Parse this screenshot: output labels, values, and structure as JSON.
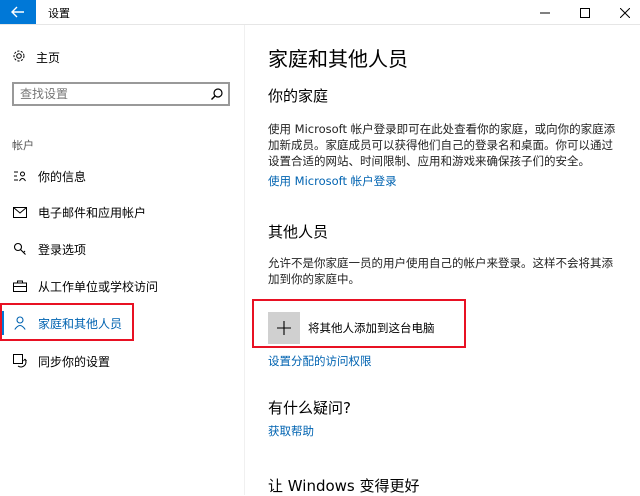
{
  "window": {
    "title": "设置",
    "back_icon": "arrow-left-icon",
    "controls": [
      "minimize-icon",
      "maximize-icon",
      "close-icon"
    ],
    "accent_color": "#0078d7"
  },
  "sidebar": {
    "home_label": "主页",
    "search_placeholder": "查找设置",
    "section_label": "帐户",
    "items": [
      {
        "label": "你的信息",
        "icon": "person-card-icon"
      },
      {
        "label": "电子邮件和应用帐户",
        "icon": "envelope-icon"
      },
      {
        "label": "登录选项",
        "icon": "key-icon"
      },
      {
        "label": "从工作单位或学校访问",
        "icon": "briefcase-icon"
      },
      {
        "label": "家庭和其他人员",
        "icon": "person-icon",
        "active": true
      },
      {
        "label": "同步你的设置",
        "icon": "sync-icon"
      }
    ],
    "highlight_color": "#e81123"
  },
  "main": {
    "title": "家庭和其他人员",
    "family": {
      "heading": "你的家庭",
      "description": "使用 Microsoft 帐户登录即可在此处查看你的家庭，或向你的家庭添加新成员。家庭成员可以获得他们自己的登录名和桌面。你可以通过设置合适的网站、时间限制、应用和游戏来确保孩子们的安全。",
      "link": "使用 Microsoft 帐户登录"
    },
    "others": {
      "heading": "其他人员",
      "description": "允许不是你家庭一员的用户使用自己的帐户来登录。这样不会将其添加到你的家庭中。",
      "add_button": "将其他人添加到这台电脑",
      "assigned_access_link": "设置分配的访问权限"
    },
    "help": {
      "heading": "有什么疑问?",
      "link": "获取帮助"
    },
    "improve": {
      "heading": "让 Windows 变得更好"
    },
    "link_color": "#0063b1"
  }
}
